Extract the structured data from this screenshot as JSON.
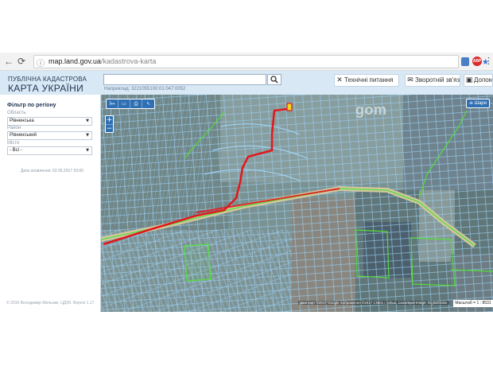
{
  "browser": {
    "url_host": "map.land.gov.ua",
    "url_path": "/kadastrova-karta",
    "back_icon": "back-arrow-icon",
    "forward_icon": "forward-arrow-icon",
    "reload_icon": "reload-icon"
  },
  "header": {
    "brand_line1": "ПУБЛІЧНА КАДАСТРОВА",
    "brand_line2": "КАРТА УКРАЇНИ",
    "search_placeholder": "",
    "search_example": "Наприклад: 3221055100:01:047:0052",
    "btn_technical": "Технічні питання",
    "btn_feedback": "Зворотній зв'язок",
    "btn_help": "Допомога"
  },
  "filter": {
    "title": "Фільтр по регіону",
    "oblast_label": "Область",
    "oblast_value": "Рівненська",
    "raion_label": "Район",
    "raion_value": "Рівненський",
    "city_label": "Місто",
    "city_value": "- Всі -",
    "update_date": "Дата оновлення: 02.05.2017 03:00",
    "copyright": "© 2016 Володимир Мельник. ЦДЗК. Версія 1.17"
  },
  "map": {
    "layers_label": "Шари",
    "watermark": "gom",
    "attribution": "Дані карт ©2017 Google Зображення ©2017 CNES / Airbus, Cnes/Spot Image, DigitalGlobe",
    "scale": "Масштаб = 1 : 8531",
    "colors": {
      "route": "#e0191e",
      "parcel": "#9fd4f5",
      "boundary": "#55dd3a",
      "highlight": "#f4d51c"
    }
  }
}
